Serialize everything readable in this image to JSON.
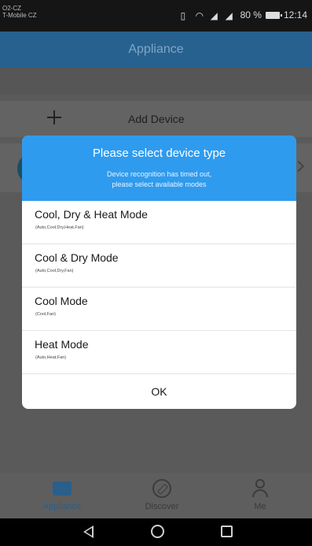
{
  "status_bar": {
    "carrier_line1": "O2-CZ",
    "carrier_line2": "T-Mobile CZ",
    "battery_percent": "80 %",
    "time": "12:14"
  },
  "header": {
    "title": "Appliance"
  },
  "page": {
    "add_device_label": "Add Device"
  },
  "dialog": {
    "title": "Please select device type",
    "message": "Device recognition has timed out,\nplease select available modes",
    "options": [
      {
        "title": "Cool, Dry & Heat Mode",
        "subtitle": "(Auto,Cool,Dry,Heat,Fan)"
      },
      {
        "title": "Cool & Dry Mode",
        "subtitle": "(Auto,Cool,Dry,Fan)"
      },
      {
        "title": "Cool Mode",
        "subtitle": "(Cool,Fan)"
      },
      {
        "title": "Heat Mode",
        "subtitle": "(Auto,Heat,Fan)"
      }
    ],
    "ok_label": "OK"
  },
  "bottom_nav": {
    "items": [
      {
        "label": "Appliance",
        "icon": "appliance-icon",
        "active": true
      },
      {
        "label": "Discover",
        "icon": "compass-icon",
        "active": false
      },
      {
        "label": "Me",
        "icon": "person-icon",
        "active": false
      }
    ]
  },
  "colors": {
    "header_bg": "#27618f",
    "dialog_header_bg": "#2f9bee",
    "active_tab": "#2a5e8b"
  }
}
